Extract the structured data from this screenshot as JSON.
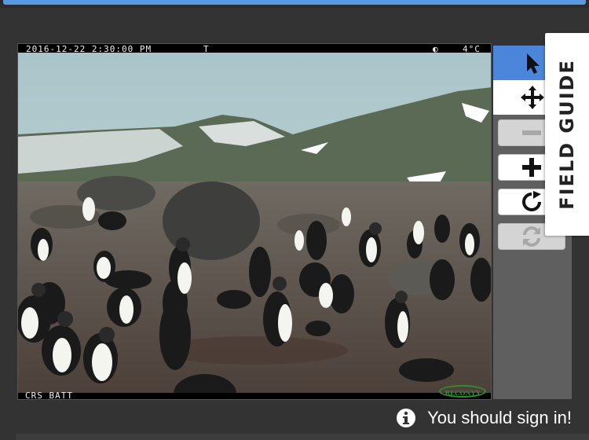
{
  "subject_image": {
    "date_stamp": "2016-12-22 2:30:00 PM",
    "t_marker": "T",
    "moon_icon": "half-moon-icon",
    "temperature": "4°C",
    "site_label": "CRS BATT",
    "brand_logo": "RECONYX"
  },
  "toolbar": {
    "pointer_icon": "pointer-arrow-icon",
    "pan_icon": "move-arrows-icon",
    "zoom_out_icon": "minus-icon",
    "zoom_in_icon": "plus-icon",
    "rotate_icon": "rotate-clockwise-icon",
    "reset_icon": "reset-refresh-icon"
  },
  "field_guide": {
    "label": "FIELD GUIDE"
  },
  "notice": {
    "icon": "info-circle-icon",
    "text": "You should sign in!"
  },
  "colors": {
    "background": "#333333",
    "active_tool": "#4c86da",
    "accent_bar": "#5a98e0"
  }
}
